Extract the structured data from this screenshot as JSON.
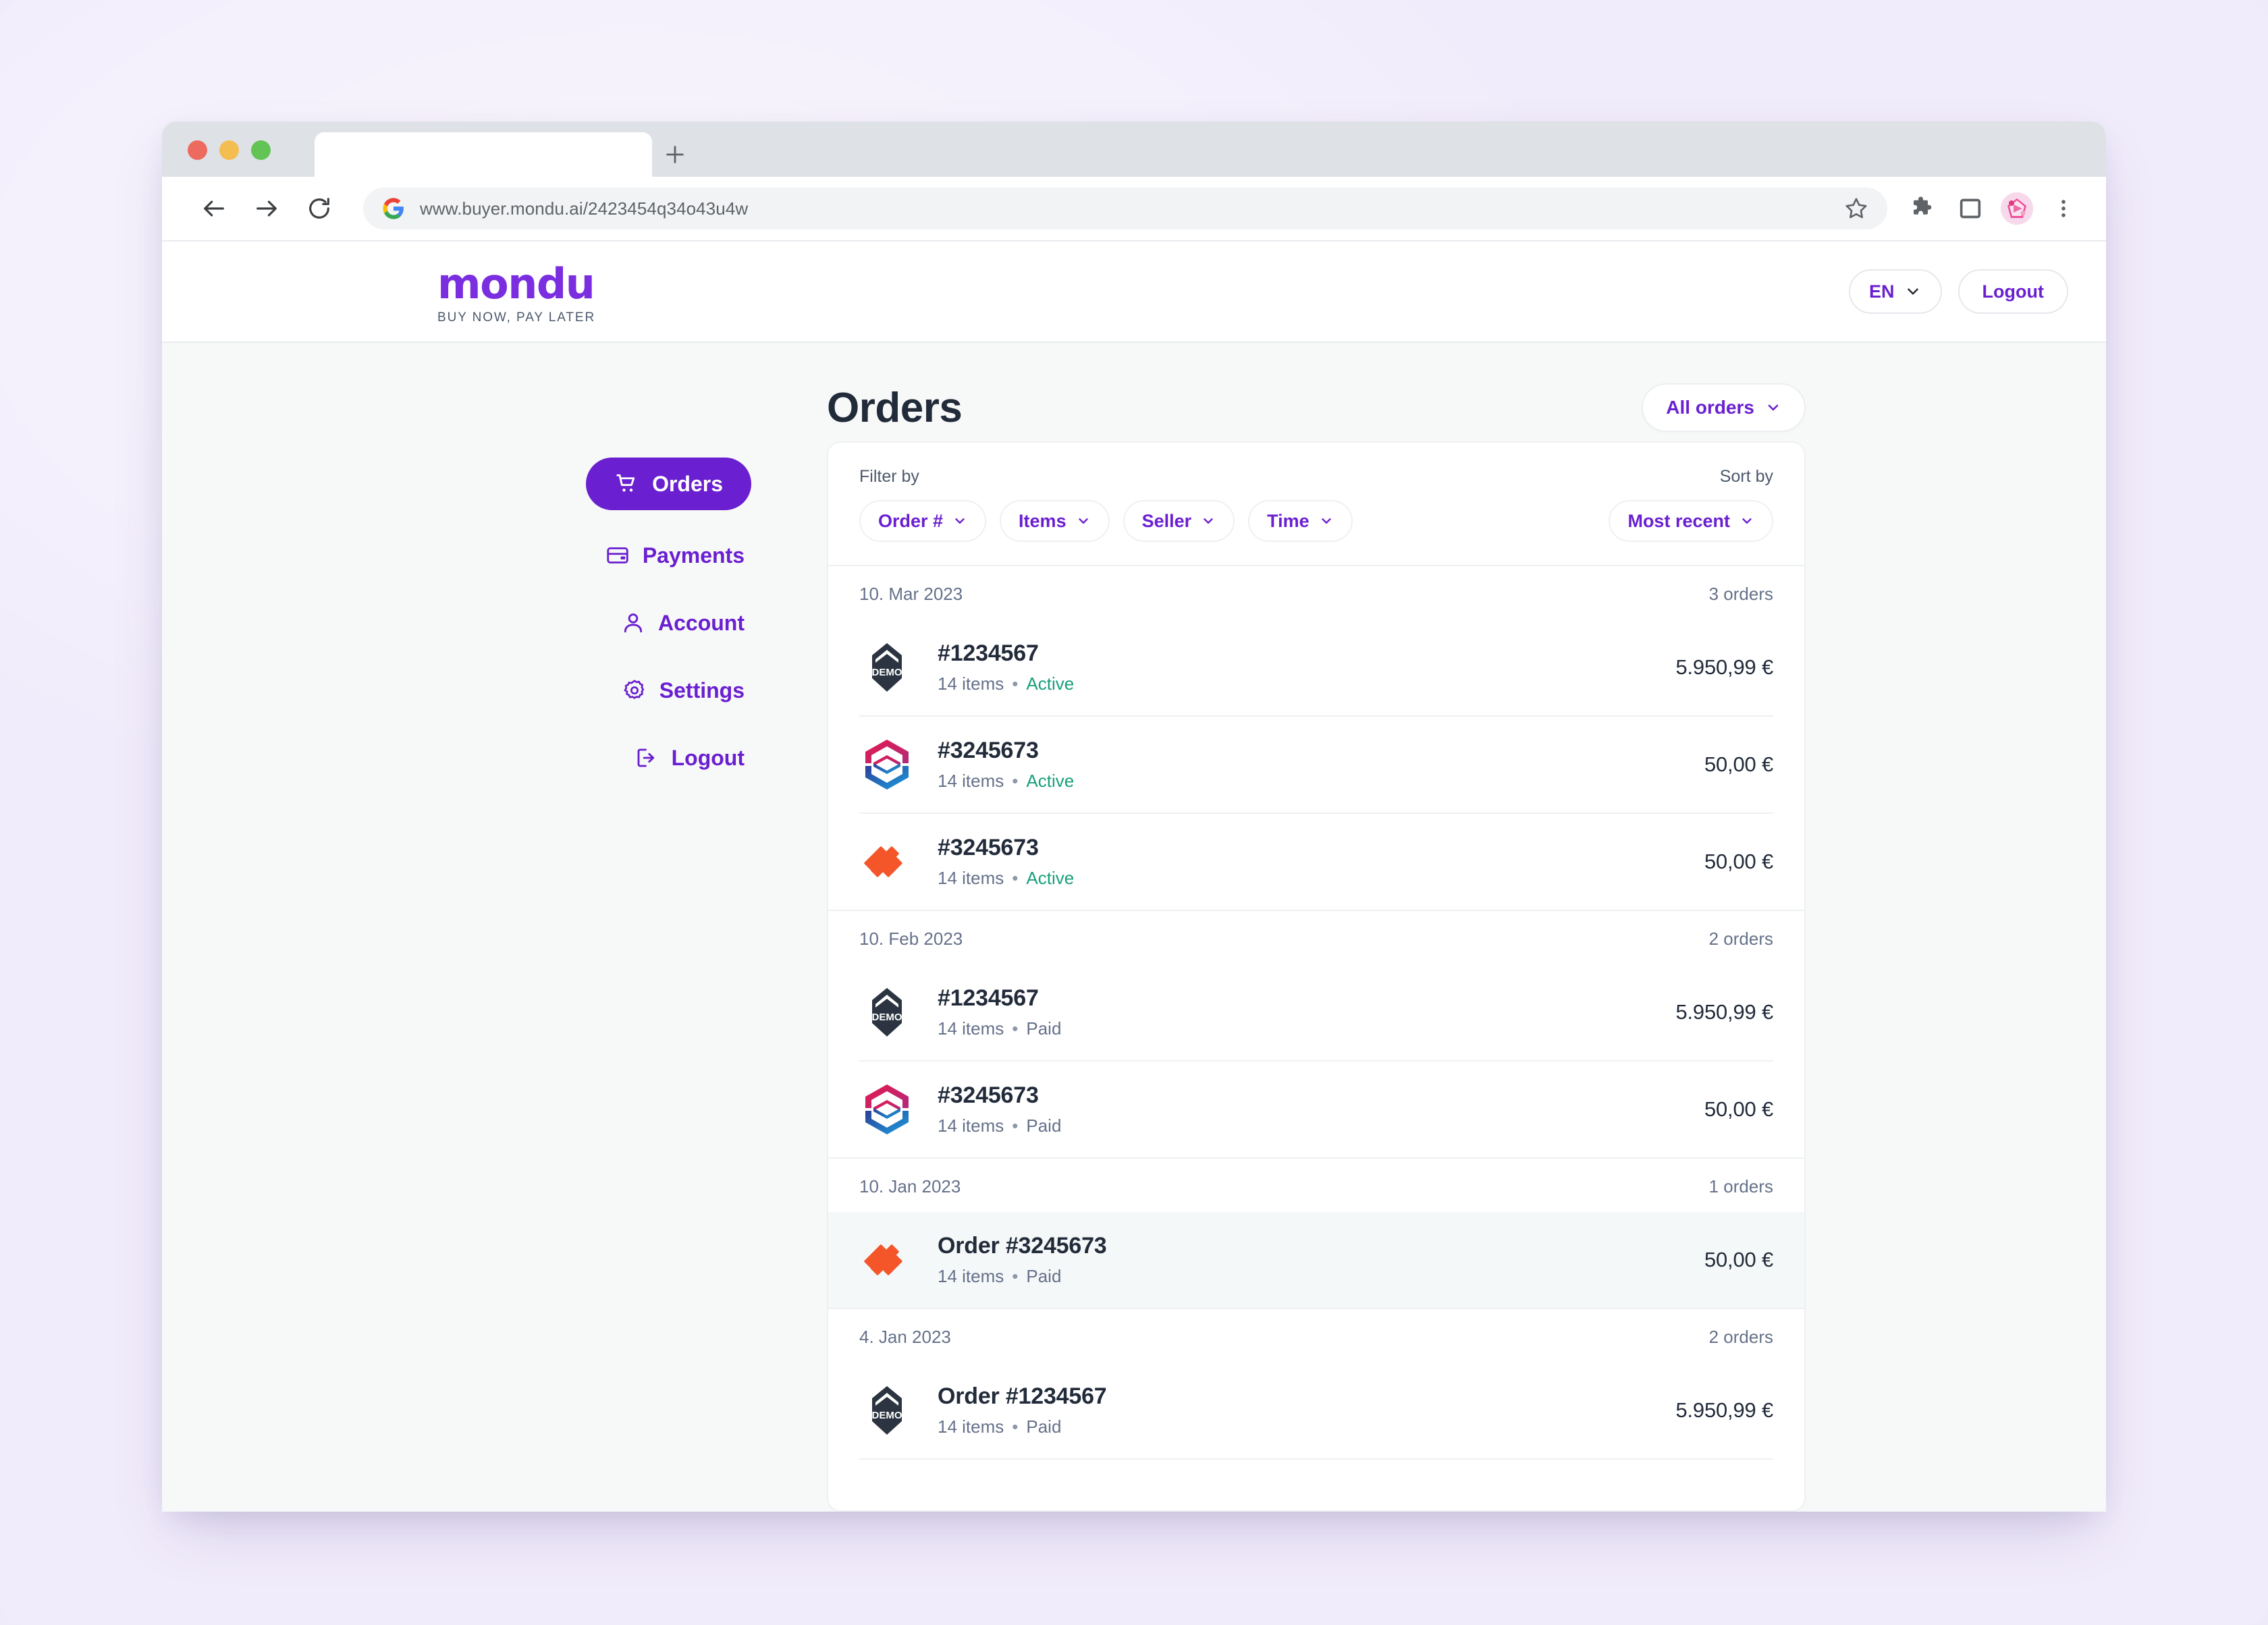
{
  "browser": {
    "tab_title": "",
    "url": "www.buyer.mondu.ai/2423454q34o43u4w",
    "new_tab_label": "+",
    "back_label": "Back",
    "forward_label": "Forward",
    "reload_label": "Reload"
  },
  "brand": {
    "name": "mondu",
    "tagline": "BUY NOW, PAY LATER",
    "accent": "#6a1fd0"
  },
  "header": {
    "language": "EN",
    "logout": "Logout"
  },
  "sidebar": {
    "items": [
      {
        "label": "Orders",
        "icon": "cart-icon",
        "active": true
      },
      {
        "label": "Payments",
        "icon": "card-icon",
        "active": false
      },
      {
        "label": "Account",
        "icon": "person-icon",
        "active": false
      },
      {
        "label": "Settings",
        "icon": "gear-icon",
        "active": false
      },
      {
        "label": "Logout",
        "icon": "signout-icon",
        "active": false
      }
    ]
  },
  "main": {
    "title": "Orders",
    "scope_filter": "All orders"
  },
  "filters": {
    "filter_by_label": "Filter by",
    "sort_by_label": "Sort by",
    "chips": [
      "Order #",
      "Items",
      "Seller",
      "Time"
    ],
    "sort_value": "Most recent"
  },
  "groups": [
    {
      "date": "10. Mar 2023",
      "count": "3 orders",
      "orders": [
        {
          "id": "#1234567",
          "items": "14 items",
          "status": "Active",
          "status_kind": "active",
          "amount": "5.950,99 €",
          "logo": "demo-shield-logo",
          "highlight": false
        },
        {
          "id": "#3245673",
          "items": "14 items",
          "status": "Active",
          "status_kind": "active",
          "amount": "50,00 €",
          "logo": "hex-chevron-logo",
          "highlight": false
        },
        {
          "id": "#3245673",
          "items": "14 items",
          "status": "Active",
          "status_kind": "active",
          "amount": "50,00 €",
          "logo": "orange-slash-logo",
          "highlight": false
        }
      ]
    },
    {
      "date": "10. Feb 2023",
      "count": "2 orders",
      "orders": [
        {
          "id": "#1234567",
          "items": "14 items",
          "status": "Paid",
          "status_kind": "paid",
          "amount": "5.950,99 €",
          "logo": "demo-shield-logo",
          "highlight": false
        },
        {
          "id": "#3245673",
          "items": "14 items",
          "status": "Paid",
          "status_kind": "paid",
          "amount": "50,00 €",
          "logo": "hex-chevron-logo",
          "highlight": false
        }
      ]
    },
    {
      "date": "10. Jan 2023",
      "count": "1 orders",
      "orders": [
        {
          "id": "Order #3245673",
          "items": "14 items",
          "status": "Paid",
          "status_kind": "paid",
          "amount": "50,00 €",
          "logo": "orange-slash-logo",
          "highlight": true
        }
      ]
    },
    {
      "date": "4. Jan 2023",
      "count": "2 orders",
      "orders": [
        {
          "id": "Order #1234567",
          "items": "14 items",
          "status": "Paid",
          "status_kind": "paid",
          "amount": "5.950,99 €",
          "logo": "demo-shield-logo",
          "highlight": false
        }
      ]
    }
  ]
}
